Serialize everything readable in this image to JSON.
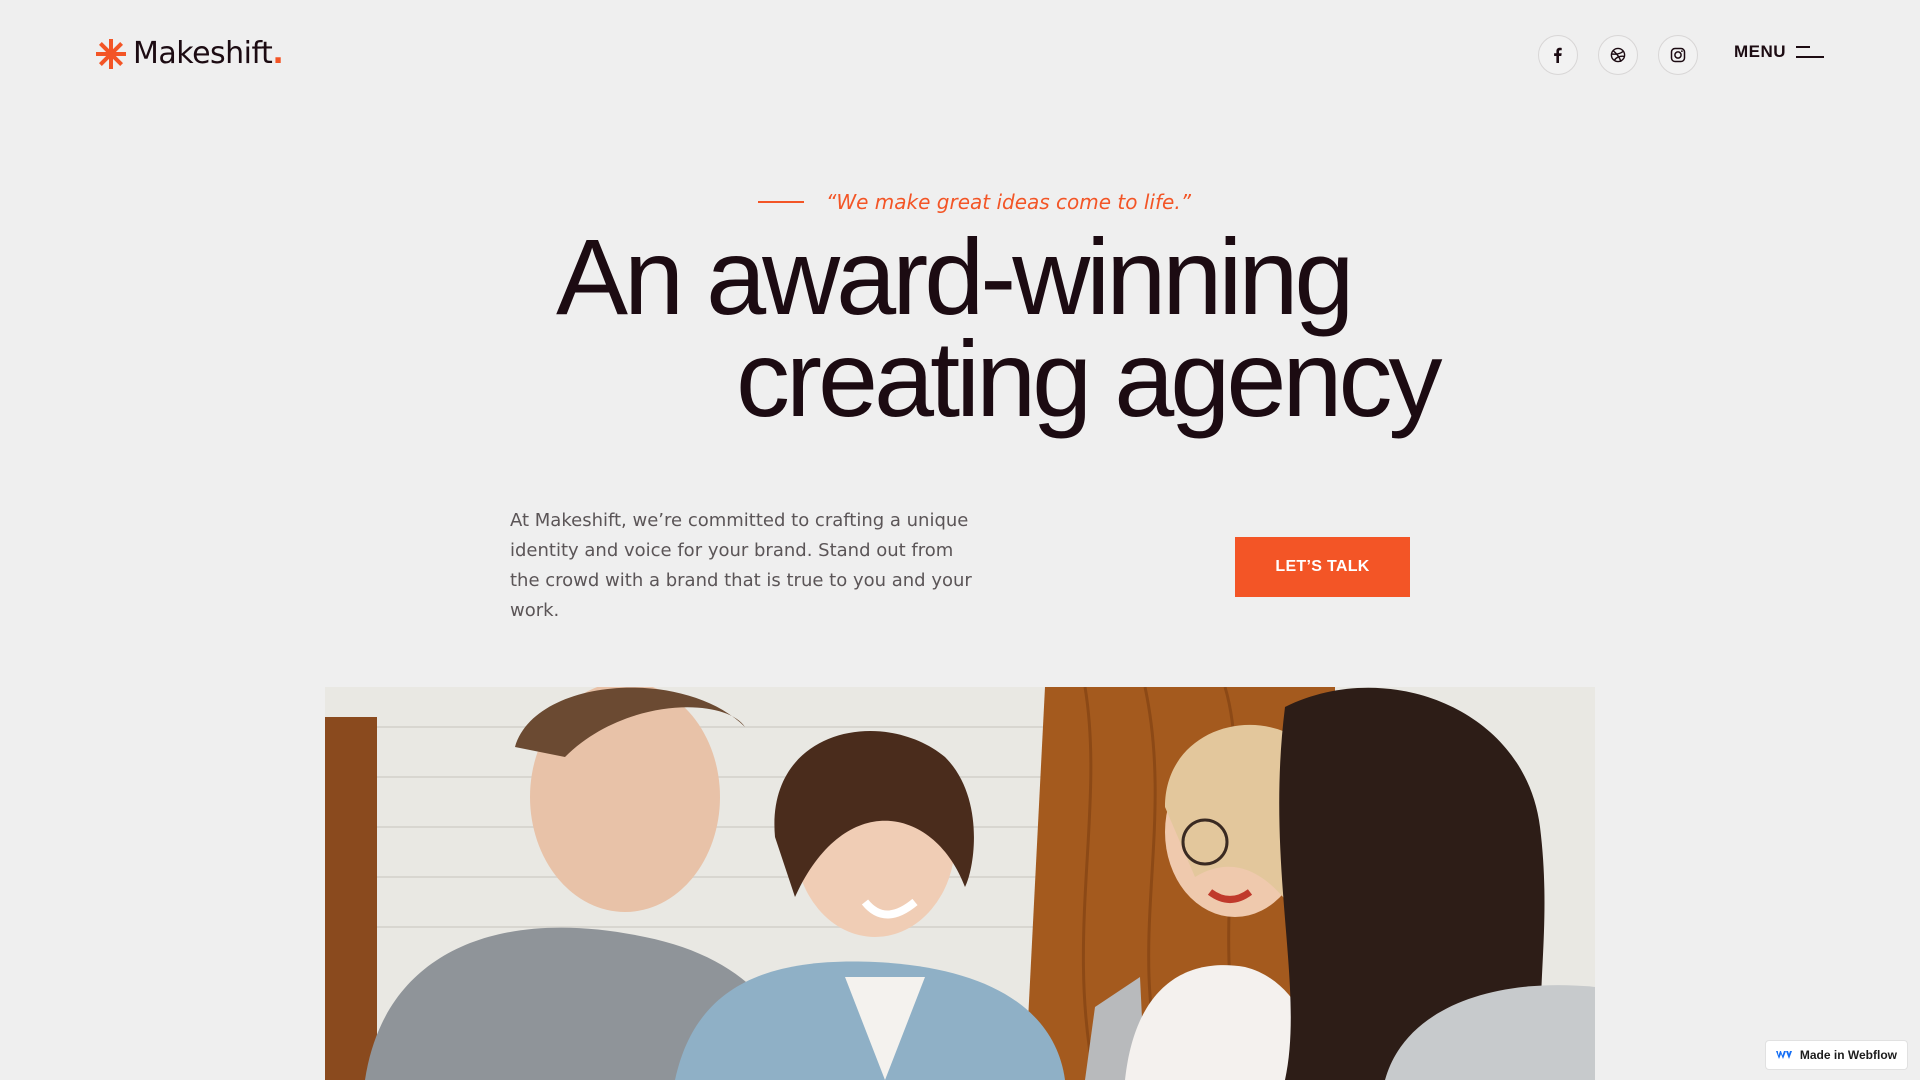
{
  "brand": {
    "name": "Makeshift",
    "dot": ".",
    "accent_color": "#f35526",
    "icon": "asterisk-logo-icon"
  },
  "header": {
    "social": [
      {
        "name": "facebook",
        "icon": "facebook-icon"
      },
      {
        "name": "dribbble",
        "icon": "dribbble-icon"
      },
      {
        "name": "instagram",
        "icon": "instagram-icon"
      }
    ],
    "menu_label": "MENU",
    "menu_icon": "hamburger-icon"
  },
  "hero": {
    "tagline": "“We make great ideas come to life.”",
    "headline_line1": "An award-winning",
    "headline_line2": "creating agency",
    "intro": "At Makeshift, we’re committed to crafting a unique identity and voice for your brand. Stand out from the crowd with a brand that is true to you and your work.",
    "cta_label": "LET’S TALK"
  },
  "photo": {
    "icon": "team-photo"
  },
  "badge": {
    "label": "Made in Webflow",
    "icon": "webflow-icon"
  },
  "colors": {
    "background": "#efefef",
    "text_dark": "#1c0b12",
    "text_body": "#5b5557",
    "accent": "#f35526"
  }
}
